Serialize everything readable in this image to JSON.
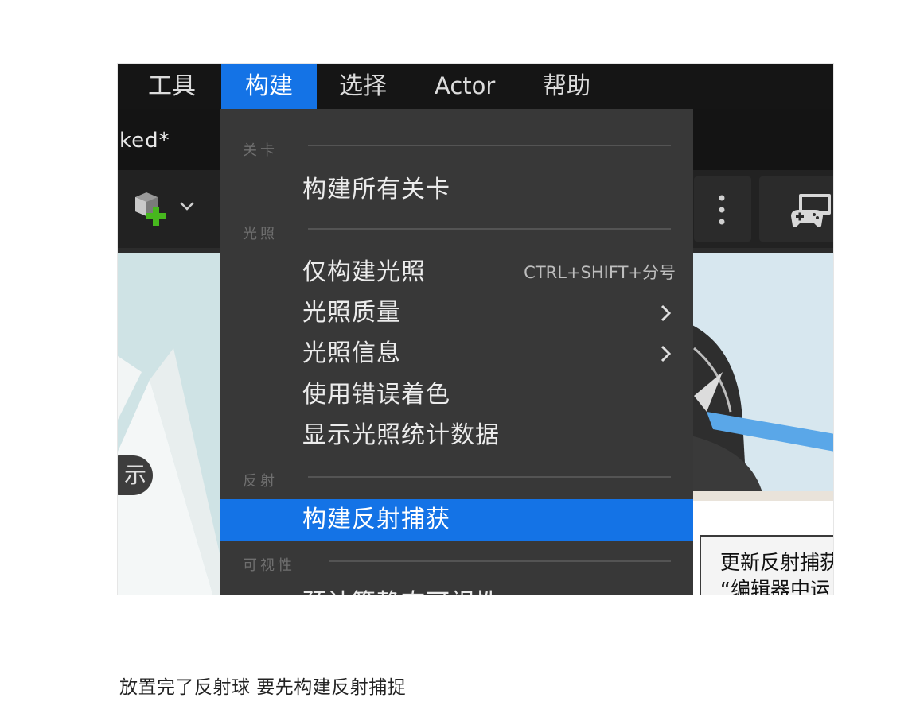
{
  "menubar": {
    "items": [
      "工具",
      "构建",
      "选择",
      "Actor",
      "帮助"
    ],
    "active": "构建"
  },
  "tab": {
    "title": "ked*"
  },
  "viewport": {
    "show_label": "示"
  },
  "tooltip": {
    "lines": [
      "更新反射捕获",
      "“编辑器中运"
    ]
  },
  "dropdown": {
    "sections": {
      "level": "关卡",
      "lighting": "光照",
      "reflection": "反射",
      "visibility": "可视性"
    },
    "items": {
      "build_all_levels": "构建所有关卡",
      "build_lighting_only": "仅构建光照",
      "build_lighting_only_shortcut": "CTRL+SHIFT+分号",
      "lighting_quality": "光照质量",
      "lighting_info": "光照信息",
      "use_error_coloring": "使用错误着色",
      "show_lighting_stats": "显示光照统计数据",
      "build_reflection_captures": "构建反射捕获",
      "precompute_static_visibility": "预计算静态可视性"
    }
  },
  "caption": "放置完了反射球  要先构建反射捕捉",
  "colors": {
    "menu_highlight": "#1473e6",
    "menu_bg": "#383838",
    "menubar_bg": "#151515"
  }
}
